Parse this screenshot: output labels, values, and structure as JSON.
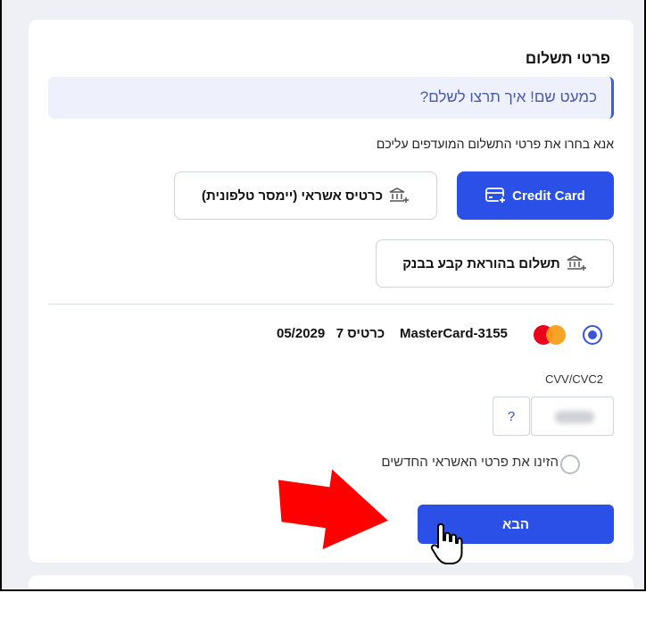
{
  "payment": {
    "title": "פרטי תשלום",
    "banner": "כמעט שם! איך תרצו לשלם?",
    "instruction": "אנא בחרו את פרטי התשלום המועדפים עליכם",
    "options": {
      "credit_card": "Credit Card",
      "phone_card": "כרטיס אשראי (יימסר טלפונית)",
      "bank_order": "תשלום בהוראת קבע בבנק"
    },
    "saved_card": {
      "name": "MasterCard-3155",
      "card_index": "כרטיס 7",
      "expiry": "05/2029"
    },
    "cvv_label": "CVV/CVC2",
    "cvv_help": "?",
    "new_card_label": "הזינו את פרטי האשראי החדשים",
    "next_button": "הבא"
  },
  "colors": {
    "accent": "#2b50e8",
    "annotation_arrow": "#ff0000"
  },
  "icons": {
    "credit_card": "credit-card-plus-icon",
    "bank": "bank-plus-icon",
    "brand": "mastercard-logo-icon",
    "annotation": "red-arrow-icon",
    "cursor": "hand-cursor-icon"
  }
}
